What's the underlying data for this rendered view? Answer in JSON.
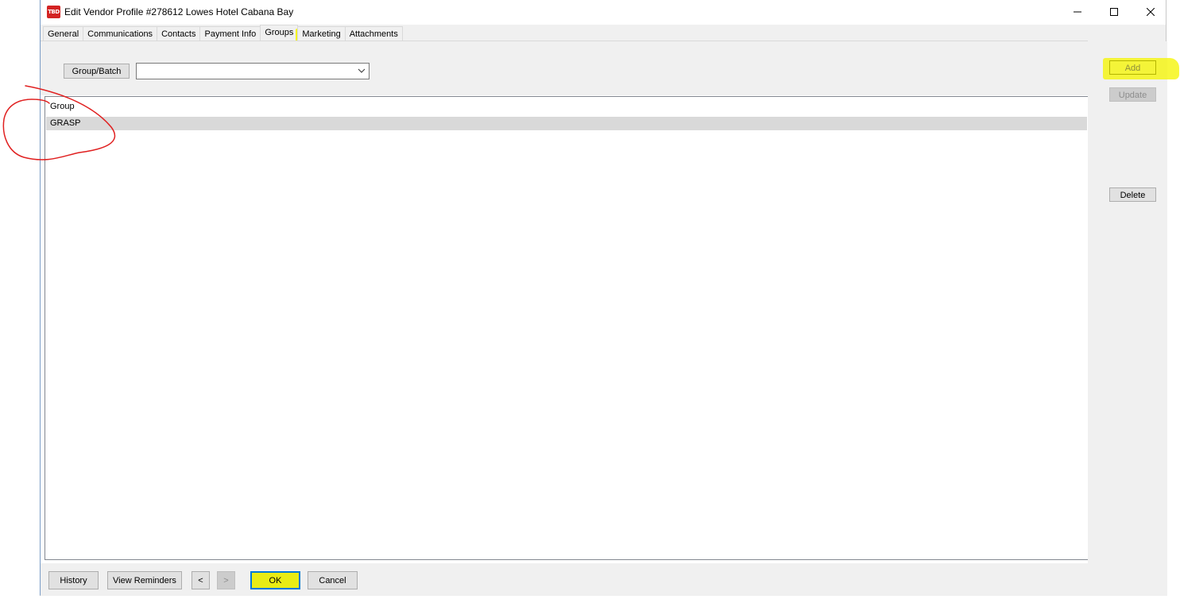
{
  "window": {
    "app_icon_text": "TBD",
    "title": "Edit Vendor Profile #278612 Lowes Hotel Cabana Bay",
    "controls": {
      "minimize_icon": "minimize-icon",
      "maximize_icon": "maximize-icon",
      "close_icon": "close-icon"
    }
  },
  "tabs": [
    {
      "label": "General"
    },
    {
      "label": "Communications"
    },
    {
      "label": "Contacts"
    },
    {
      "label": "Payment Info"
    },
    {
      "label": "Groups",
      "active": true
    },
    {
      "label": "Marketing"
    },
    {
      "label": "Attachments"
    }
  ],
  "filter": {
    "group_batch_label": "Group/Batch",
    "dropdown_value": ""
  },
  "list": {
    "header": "Group",
    "rows": [
      {
        "group": "GRASP",
        "selected": true
      }
    ]
  },
  "actions": {
    "add_label": "Add",
    "update_label": "Update",
    "delete_label": "Delete"
  },
  "footer": {
    "history_label": "History",
    "reminders_label": "View Reminders",
    "prev_label": "<",
    "next_label": ">",
    "ok_label": "OK",
    "cancel_label": "Cancel"
  },
  "colors": {
    "highlight": "#f5f50a",
    "annotation": "#e02020",
    "selected_row": "#d9d9d9",
    "focus_border": "#0078d7"
  }
}
